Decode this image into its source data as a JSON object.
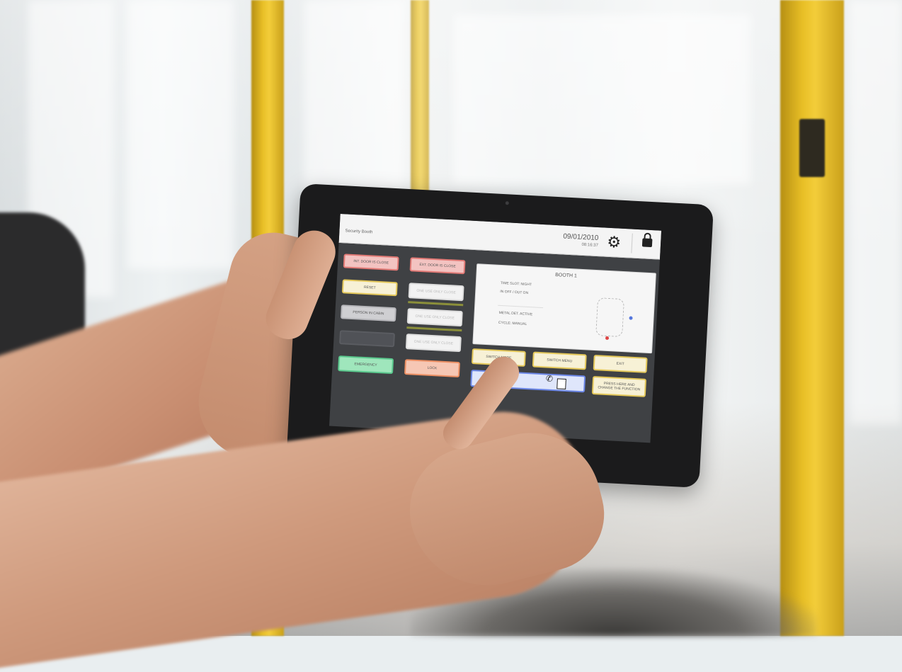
{
  "header": {
    "title": "Security Booth",
    "date": "09/01/2010",
    "time": "08:16:37"
  },
  "buttons": {
    "left_col": [
      {
        "label": "INT. DOOR IS CLOSE"
      },
      {
        "label": "RESET"
      },
      {
        "label": "PERSON IN CABIN"
      },
      {
        "label": ""
      },
      {
        "label": "EMERGENCY"
      }
    ],
    "mid_col": [
      {
        "label": "EXT. DOOR IS CLOSE"
      },
      {
        "label": "ONE USE ONLY CLOSE"
      },
      {
        "label": "ONE USE ONLY CLOSE"
      },
      {
        "label": "ONE USE ONLY CLOSE"
      },
      {
        "label": "LOCK"
      }
    ],
    "bottom_row": [
      {
        "label": "SWITCH MODE"
      },
      {
        "label": "SWITCH MENU"
      },
      {
        "label": "EXIT"
      }
    ],
    "service": {
      "label": "PRESS HERE AND CHANGE THE FUNCTION"
    }
  },
  "booth": {
    "title": "BOOTH 1",
    "lines": [
      "TIME SLOT: NIGHT",
      "IN OFF / OUT ON",
      "METAL DET. ACTIVE",
      "CYCLE: MANUAL"
    ]
  },
  "colors": {
    "pole": "#e8bf26",
    "red_button": "#e27a76",
    "yellow_button": "#e4c85a",
    "green_button": "#5bc98e",
    "blue_button": "#6b86e6"
  }
}
